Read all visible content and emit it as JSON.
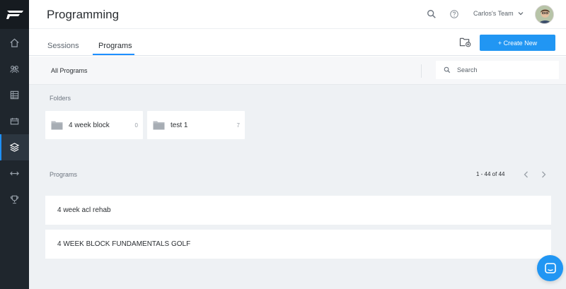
{
  "app": {
    "brand_color": "#2196f3",
    "sidebar_bg": "#1f262d"
  },
  "sidebar": {
    "items": [
      {
        "icon": "home-icon",
        "active": false
      },
      {
        "icon": "team-icon",
        "active": false
      },
      {
        "icon": "table-icon",
        "active": false
      },
      {
        "icon": "calendar-icon",
        "active": false
      },
      {
        "icon": "layers-icon",
        "active": true
      },
      {
        "icon": "arrows-horizontal-icon",
        "active": false
      },
      {
        "icon": "trophy-icon",
        "active": false
      }
    ]
  },
  "header": {
    "title": "Programming",
    "team_label": "Carlos's Team",
    "icons": [
      "search-icon",
      "help-icon",
      "chevron-down-icon",
      "avatar"
    ]
  },
  "tabs": [
    {
      "label": "Sessions",
      "active": false
    },
    {
      "label": "Programs",
      "active": true
    }
  ],
  "toolbar": {
    "create_label": "+ Create New",
    "folder_add_icon": "folder-add-icon"
  },
  "filter": {
    "scope_label": "All Programs",
    "search_placeholder": "Search"
  },
  "folders": {
    "heading": "Folders",
    "items": [
      {
        "name": "4 week block",
        "count": "0"
      },
      {
        "name": "test 1",
        "count": "7"
      }
    ]
  },
  "programs": {
    "heading": "Programs",
    "pagination": "1 - 44 of 44",
    "items": [
      {
        "name": "4 week acl rehab"
      },
      {
        "name": "4 WEEK BLOCK FUNDAMENTALS GOLF"
      }
    ]
  },
  "chat": {
    "icon": "chat-icon"
  }
}
